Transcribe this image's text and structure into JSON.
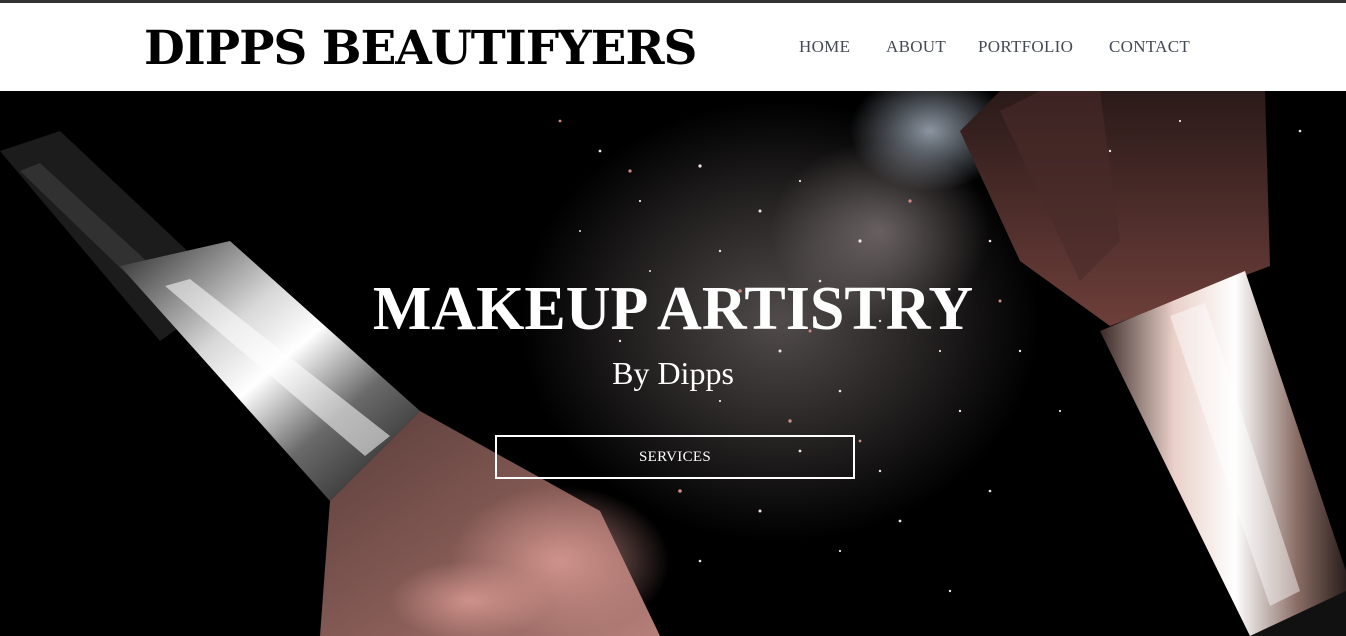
{
  "header": {
    "brand": "DIPPS BEAUTIFYERS",
    "nav": {
      "home": "HOME",
      "about": "ABOUT",
      "portfolio": "PORTFOLIO",
      "contact": "CONTACT"
    }
  },
  "hero": {
    "title": "MAKEUP ARTISTRY",
    "subtitle": "By Dipps",
    "cta_label": "SERVICES",
    "background_image": "makeup-brushes-powder-photo"
  },
  "colors": {
    "header_bg": "#ffffff",
    "brand_text": "#000000",
    "nav_text": "#444a55",
    "hero_bg": "#000000",
    "hero_text": "#ffffff"
  }
}
